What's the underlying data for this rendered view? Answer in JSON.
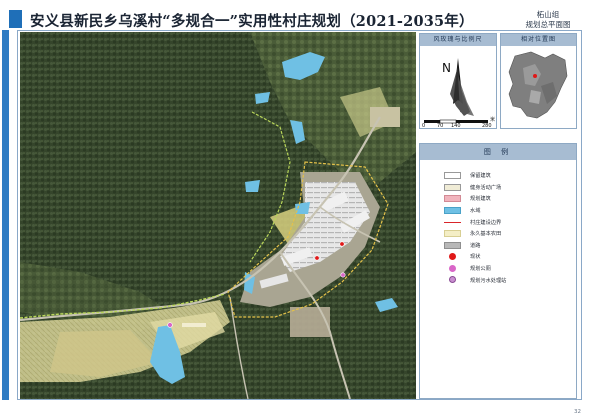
{
  "title": "安义县新民乡乌溪村“多规合一”实用性村庄规划（2021-2035年）",
  "subtitle": {
    "group": "柘山组",
    "sheet": "规划总平面图"
  },
  "panels": {
    "scale": {
      "header": "风玫瑰与比例尺",
      "north": "N",
      "ticks": [
        "0",
        "70",
        "140",
        "280"
      ],
      "unit": "米"
    },
    "location": {
      "header": "相对位置图"
    },
    "legend": {
      "header": "图 例",
      "items": [
        {
          "label": "保留建筑",
          "icon": "retained-building",
          "color": "#ffffff"
        },
        {
          "label": "健身活动广场",
          "icon": "fitness-square",
          "color": "#f0ecd6"
        },
        {
          "label": "规划建筑",
          "icon": "planned-building",
          "color": "#f1b4bd"
        },
        {
          "label": "水域",
          "icon": "water",
          "color": "#6fc0e4"
        },
        {
          "label": "村庄建设边界",
          "icon": "village-boundary",
          "color": "#d9252a"
        },
        {
          "label": "永久基本农田",
          "icon": "farmland",
          "color": "#f4eec6"
        },
        {
          "label": "道路",
          "icon": "road",
          "color": "#b8b8b8"
        },
        {
          "label": "现状",
          "icon": "current",
          "color": "#e01818"
        },
        {
          "label": "规划公厕",
          "icon": "planned-toilet",
          "color": "#d966c8"
        },
        {
          "label": "规划污水处理站",
          "icon": "sewage-station",
          "color": "#c98fd0"
        }
      ]
    }
  },
  "page_number": "32"
}
